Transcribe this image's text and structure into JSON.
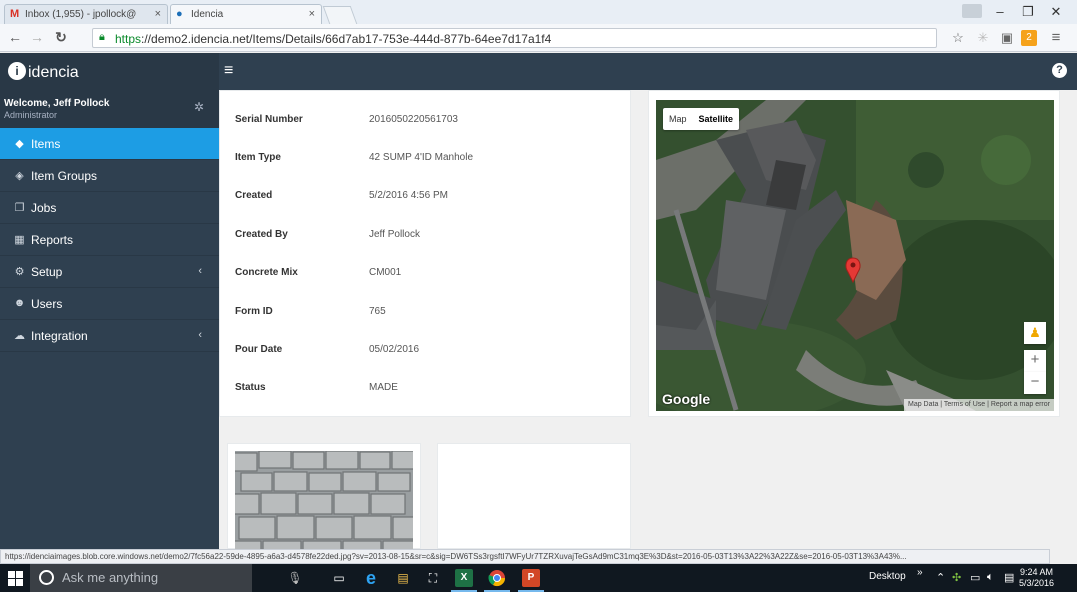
{
  "browser": {
    "tabs": [
      {
        "title": "Inbox (1,955) - jpollock@",
        "active": false
      },
      {
        "title": "Idencia",
        "active": true
      }
    ],
    "url_scheme": "https",
    "url_rest": "://demo2.idencia.net/Items/Details/66d7ab17-753e-444d-877b-64ee7d17a1f4",
    "status_url": "https://idenciaimages.blob.core.windows.net/demo2/7fc56a22-59de-4895-a6a3-d4578fe22ded.jpg?sv=2013-08-15&sr=c&sig=DW6TSs3rgsftI7WFyUr7TZRXuvajTeGsAd9mC31mq3E%3D&st=2016-05-03T13%3A22%3A22Z&se=2016-05-03T13%3A43%...",
    "ext_badge": "2"
  },
  "app": {
    "brand": "idencia",
    "user_name": "Welcome, Jeff Pollock",
    "user_role": "Administrator"
  },
  "sidebar": {
    "items": [
      {
        "label": "Items",
        "icon": "tag-icon",
        "active": true
      },
      {
        "label": "Item Groups",
        "icon": "tags-icon",
        "active": false
      },
      {
        "label": "Jobs",
        "icon": "copy-icon",
        "active": false
      },
      {
        "label": "Reports",
        "icon": "chart-icon",
        "active": false
      },
      {
        "label": "Setup",
        "icon": "cogs-icon",
        "active": false,
        "has_chevron": true
      },
      {
        "label": "Users",
        "icon": "users-icon",
        "active": false
      },
      {
        "label": "Integration",
        "icon": "cloud-icon",
        "active": false,
        "has_chevron": true
      }
    ]
  },
  "details": {
    "rows": [
      {
        "label": "Serial Number",
        "value": "2016050220561703"
      },
      {
        "label": "Item Type",
        "value": "42 SUMP 4'ID Manhole"
      },
      {
        "label": "Created",
        "value": "5/2/2016 4:56 PM"
      },
      {
        "label": "Created By",
        "value": "Jeff Pollock"
      },
      {
        "label": "Concrete Mix",
        "value": "CM001"
      },
      {
        "label": "Form ID",
        "value": "765"
      },
      {
        "label": "Pour Date",
        "value": "05/02/2016"
      },
      {
        "label": "Status",
        "value": "MADE"
      }
    ]
  },
  "map": {
    "type_map": "Map",
    "type_satellite": "Satellite",
    "zoom_in": "+",
    "zoom_out": "−",
    "google": "Google",
    "footer": "Map Data | Terms of Use | Report a map error",
    "marker_color": "#e53935"
  },
  "taskbar": {
    "search_placeholder": "Ask me anything",
    "desktop_label": "Desktop",
    "time": "9:24 AM",
    "date": "5/3/2016"
  }
}
